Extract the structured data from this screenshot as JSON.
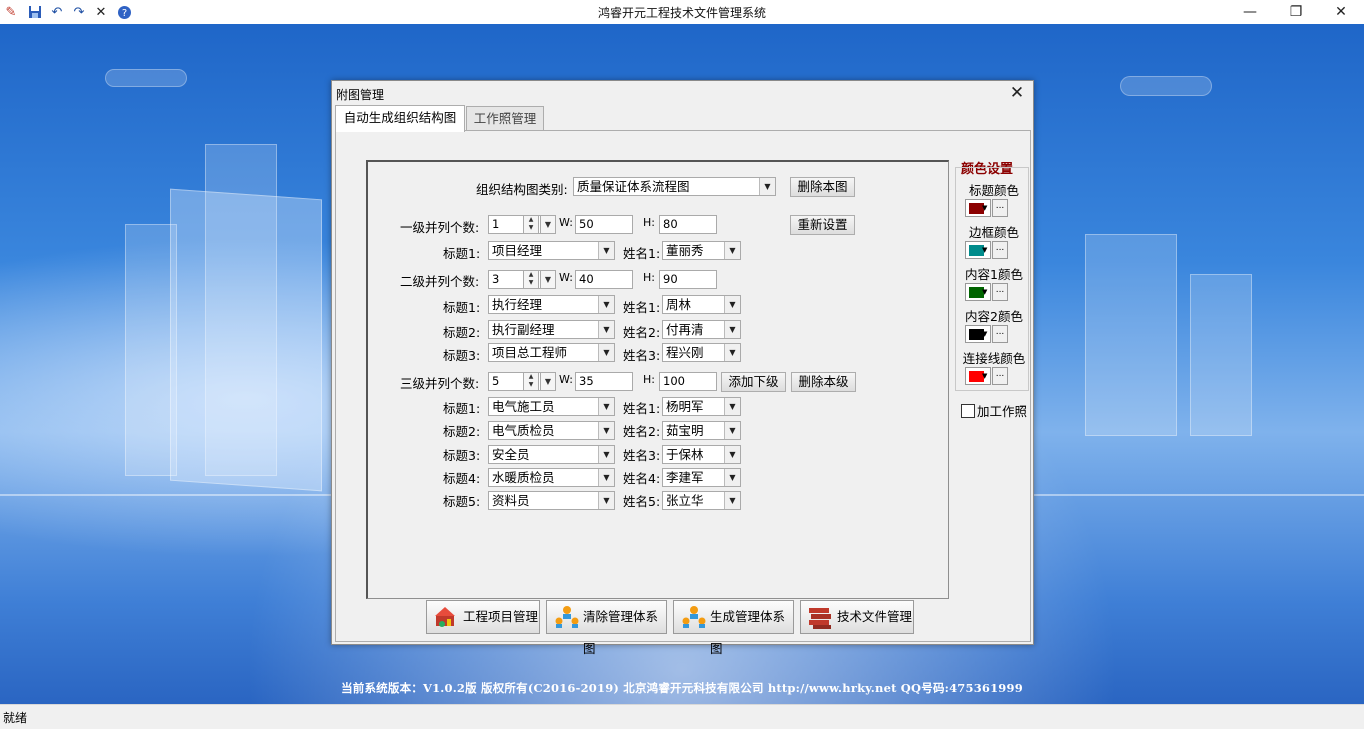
{
  "app": {
    "title": "鸿睿开元工程技术文件管理系统",
    "toolbar_icons": [
      "app-icon",
      "save-icon",
      "undo-icon",
      "redo-icon",
      "close-x-icon",
      "help-icon"
    ],
    "window_controls": [
      "minimize-icon",
      "restore-icon",
      "close-icon"
    ]
  },
  "footer": {
    "version_text": "当前系统版本：V1.0.2版  版权所有(C2016-2019)  北京鸿睿开元科技有限公司  http://www.hrky.net QQ号码:475361999"
  },
  "status": {
    "text": "就绪"
  },
  "dialog": {
    "title": "附图管理",
    "tabs": [
      {
        "label": "自动生成组织结构图",
        "active": true
      },
      {
        "label": "工作照管理",
        "active": false
      }
    ],
    "category_label": "组织结构图类别:",
    "category_value": "质量保证体系流程图",
    "delete_chart_btn": "删除本图",
    "reset_btn": "重新设置",
    "add_sub_btn": "添加下级",
    "delete_level_btn": "删除本级",
    "w_label": "W:",
    "h_label": "H:",
    "level1": {
      "label": "一级并列个数:",
      "count": "1",
      "w": "50",
      "h": "80",
      "rows": [
        {
          "title_label": "标题1:",
          "title": "项目经理",
          "name_label": "姓名1:",
          "name": "董丽秀"
        }
      ]
    },
    "level2": {
      "label": "二级并列个数:",
      "count": "3",
      "w": "40",
      "h": "90",
      "rows": [
        {
          "title_label": "标题1:",
          "title": "执行经理",
          "name_label": "姓名1:",
          "name": "周林"
        },
        {
          "title_label": "标题2:",
          "title": "执行副经理",
          "name_label": "姓名2:",
          "name": "付再清"
        },
        {
          "title_label": "标题3:",
          "title": "项目总工程师",
          "name_label": "姓名3:",
          "name": "程兴刚"
        }
      ]
    },
    "level3": {
      "label": "三级并列个数:",
      "count": "5",
      "w": "35",
      "h": "100",
      "rows": [
        {
          "title_label": "标题1:",
          "title": "电气施工员",
          "name_label": "姓名1:",
          "name": "杨明军"
        },
        {
          "title_label": "标题2:",
          "title": "电气质检员",
          "name_label": "姓名2:",
          "name": "茹宝明"
        },
        {
          "title_label": "标题3:",
          "title": "安全员",
          "name_label": "姓名3:",
          "name": "于保林"
        },
        {
          "title_label": "标题4:",
          "title": "水暖质检员",
          "name_label": "姓名4:",
          "name": "李建军"
        },
        {
          "title_label": "标题5:",
          "title": "资料员",
          "name_label": "姓名5:",
          "name": "张立华"
        }
      ]
    },
    "color_settings": {
      "title": "颜色设置",
      "items": [
        {
          "label": "标题颜色",
          "color": "#8b0000"
        },
        {
          "label": "边框颜色",
          "color": "#008b8b"
        },
        {
          "label": "内容1颜色",
          "color": "#006400"
        },
        {
          "label": "内容2颜色",
          "color": "#000000"
        },
        {
          "label": "连接线颜色",
          "color": "#ff0000"
        }
      ],
      "more_label": "...",
      "add_photo_label": "加工作照",
      "add_photo_checked": false
    },
    "bottom_buttons": [
      {
        "label": "工程项目管理",
        "icon": "project-icon"
      },
      {
        "label": "清除管理体系图",
        "icon": "clear-org-icon"
      },
      {
        "label": "生成管理体系图",
        "icon": "generate-org-icon"
      },
      {
        "label": "技术文件管理",
        "icon": "books-icon"
      }
    ]
  }
}
